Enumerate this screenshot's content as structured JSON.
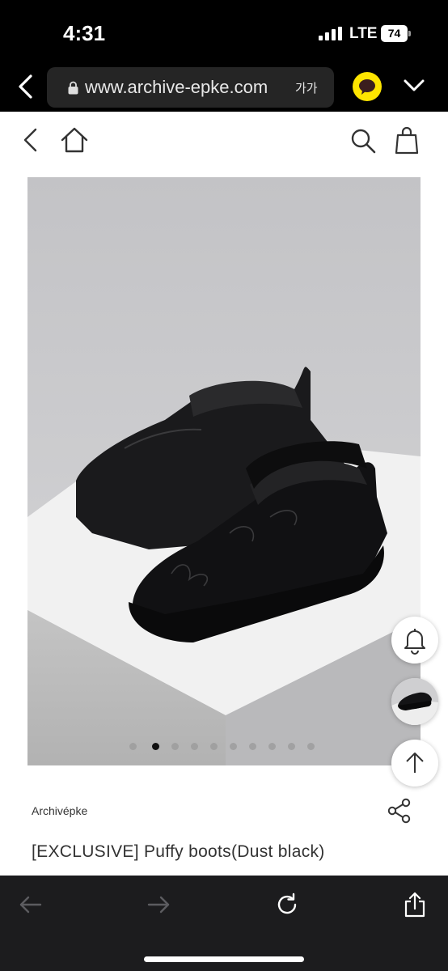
{
  "status_bar": {
    "time": "4:31",
    "network": "LTE",
    "battery": "74"
  },
  "browser": {
    "url": "www.archive-epke.com",
    "text_size_label": "가가",
    "icons": [
      "back-icon",
      "lock-icon",
      "kakao-talk-icon",
      "chevron-down-icon"
    ]
  },
  "site_header": {
    "icons": [
      "back-icon",
      "home-icon",
      "search-icon",
      "shopping-bag-icon"
    ]
  },
  "gallery": {
    "image_description_icon": "product-photo",
    "dot_count": 10,
    "active_index": 1
  },
  "floating_buttons": [
    "bell-icon",
    "recent-product-thumbnail",
    "arrow-up-icon"
  ],
  "product": {
    "brand": "Archivépke",
    "title": "[EXCLUSIVE] Puffy boots(Dust black)"
  },
  "toolbar": {
    "icons": [
      "back-arrow-icon",
      "forward-arrow-icon",
      "reload-icon",
      "share-icon"
    ]
  },
  "colors": {
    "kakao": "#FEE500",
    "toolbar_bg": "#1c1c1e",
    "url_field_bg": "#252525"
  }
}
